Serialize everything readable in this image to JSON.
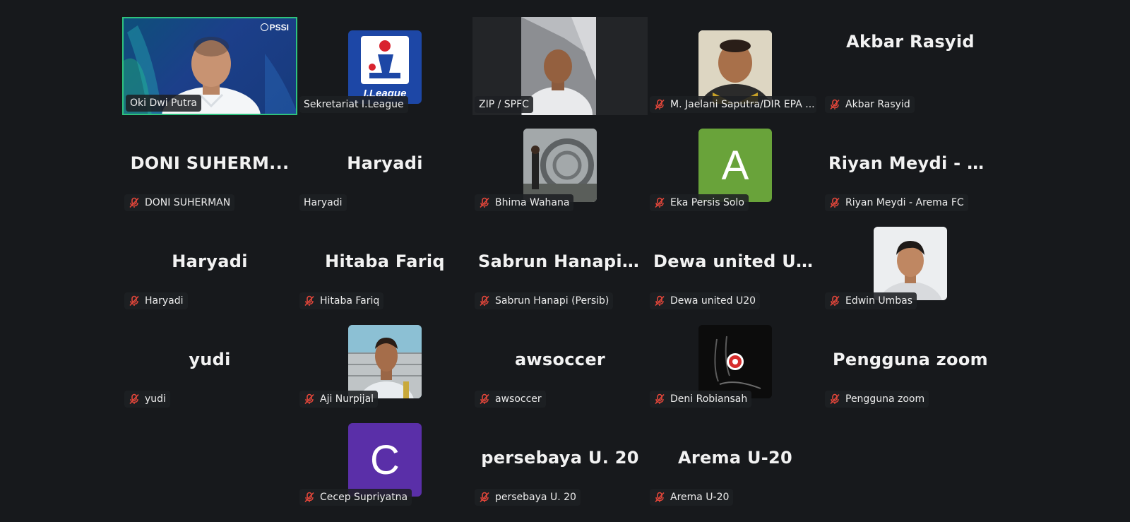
{
  "participants": [
    {
      "name": "Oki Dwi Putra",
      "label": "Oki Dwi Putra",
      "muted": false,
      "type": "video-presenter",
      "active": true
    },
    {
      "name": "Sekretariat I.League",
      "label": "Sekretariat I.League",
      "muted": false,
      "type": "logo-ileague",
      "logo_text": "I.League"
    },
    {
      "name": "ZIP / SPFC",
      "label": "ZIP / SPFC",
      "muted": false,
      "type": "video-portrait"
    },
    {
      "name": "M. Jaelani Saputra/DIR EPA PSIS",
      "label": "M. Jaelani Saputra/DIR EPA ...",
      "muted": true,
      "type": "photo-avatar"
    },
    {
      "name": "Akbar Rasyid",
      "label": "Akbar Rasyid",
      "muted": true,
      "type": "name-top"
    },
    {
      "name": "DONI SUHERM...",
      "label": "DONI SUHERMAN",
      "muted": true,
      "type": "name"
    },
    {
      "name": "Haryadi",
      "label": "Haryadi",
      "muted": false,
      "type": "name"
    },
    {
      "name": "Bhima Wahana",
      "label": "Bhima Wahana",
      "muted": true,
      "type": "photo-avatar"
    },
    {
      "name": "Eka Persis Solo",
      "label": "Eka Persis Solo",
      "muted": true,
      "type": "letter-avatar",
      "letter": "A",
      "color": "#69a33a"
    },
    {
      "name": "Riyan Meydi - A...",
      "label": "Riyan Meydi - Arema FC",
      "muted": true,
      "type": "name"
    },
    {
      "name": "Haryadi",
      "label": "Haryadi",
      "muted": true,
      "type": "name"
    },
    {
      "name": "Hitaba Fariq",
      "label": "Hitaba Fariq",
      "muted": true,
      "type": "name"
    },
    {
      "name": "Sabrun Hanapi...",
      "label": "Sabrun Hanapi (Persib)",
      "muted": true,
      "type": "name"
    },
    {
      "name": "Dewa united U20",
      "label": "Dewa united U20",
      "muted": true,
      "type": "name"
    },
    {
      "name": "Edwin Umbas",
      "label": "Edwin Umbas",
      "muted": true,
      "type": "photo-avatar"
    },
    {
      "name": "yudi",
      "label": "yudi",
      "muted": true,
      "type": "name"
    },
    {
      "name": "Aji Nurpijal",
      "label": "Aji Nurpijal",
      "muted": true,
      "type": "photo-avatar"
    },
    {
      "name": "awsoccer",
      "label": "awsoccer",
      "muted": true,
      "type": "name"
    },
    {
      "name": "Deni Robiansah",
      "label": "Deni Robiansah",
      "muted": true,
      "type": "photo-avatar"
    },
    {
      "name": "Pengguna zoom",
      "label": "Pengguna zoom",
      "muted": true,
      "type": "name"
    },
    {
      "name": "Cecep Supriyatna",
      "label": "Cecep Supriyatna",
      "muted": true,
      "type": "letter-avatar",
      "letter": "C",
      "color": "#5a2fa8"
    },
    {
      "name": "persebaya U. 20",
      "label": "persebaya U. 20",
      "muted": true,
      "type": "name"
    },
    {
      "name": "Arema U-20",
      "label": "Arema U-20",
      "muted": true,
      "type": "name"
    }
  ],
  "presenter_overlay": {
    "org": "PSSI"
  },
  "icons": {
    "mute": "microphone-muted-icon"
  },
  "colors": {
    "active_speaker_border": "#2ec27e",
    "mute_icon": "#e2463a",
    "background": "#17191c"
  }
}
